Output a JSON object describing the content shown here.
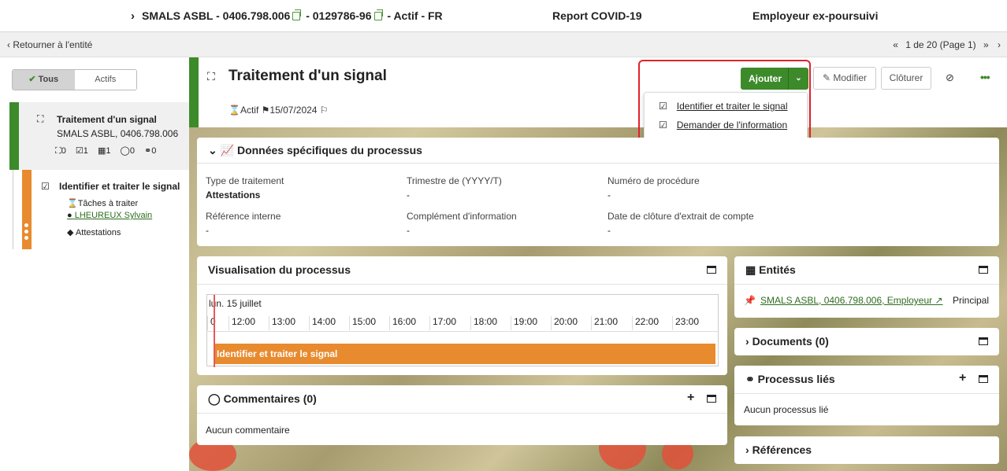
{
  "topbar": {
    "entity": "SMALS ASBL - 0406.798.006",
    "sep1": " - ",
    "code": "0129786-96",
    "status": " - Actif - FR",
    "report": "Report COVID-19",
    "employer": "Employeur ex-poursuivi"
  },
  "nav": {
    "back": "Retourner à l'entité",
    "pager": "1 de 20 (Page 1)"
  },
  "sidebar": {
    "toggle_all": "Tous",
    "toggle_active": "Actifs",
    "process": {
      "title": "Traitement d'un signal",
      "sub": "SMALS ASBL, 0406.798.006",
      "counts": [
        "0",
        "1",
        "1",
        "0",
        "0"
      ]
    },
    "task": {
      "title": "Identifier et traiter le signal",
      "status": "Tâches à traiter",
      "user": "LHEUREUX Sylvain",
      "tag": "Attestations"
    }
  },
  "header": {
    "title": "Traitement d'un signal",
    "status": "Actif",
    "date": "15/07/2024"
  },
  "actions": {
    "add": "Ajouter",
    "modify": "Modifier",
    "close": "Clôturer"
  },
  "menu": {
    "items": [
      "Identifier et traiter le signal",
      "Demander de l'information"
    ]
  },
  "specific": {
    "title": "Données spécifiques du processus",
    "fields": [
      {
        "label": "Type de traitement",
        "value": "Attestations"
      },
      {
        "label": "Trimestre de (YYYY/T)",
        "value": "-"
      },
      {
        "label": "Numéro de procédure",
        "value": "-"
      },
      {
        "label": "Référence interne",
        "value": "-"
      },
      {
        "label": "Complément d'information",
        "value": "-"
      },
      {
        "label": "Date de clôture d'extrait de compte",
        "value": "-"
      }
    ]
  },
  "visual": {
    "title": "Visualisation du processus",
    "day": "lun. 15 juillet",
    "hours": [
      "0",
      "12:00",
      "13:00",
      "14:00",
      "15:00",
      "16:00",
      "17:00",
      "18:00",
      "19:00",
      "20:00",
      "21:00",
      "22:00",
      "23:00"
    ],
    "bar": "Identifier et traiter le signal"
  },
  "comments": {
    "title": "Commentaires (0)",
    "empty": "Aucun commentaire"
  },
  "entities": {
    "title": "Entités",
    "link": "SMALS ASBL, 0406.798.006, Employeur",
    "role": "Principal"
  },
  "documents": {
    "title": "Documents (0)"
  },
  "linked": {
    "title": "Processus liés",
    "empty": "Aucun processus lié"
  },
  "references": {
    "title": "Références"
  },
  "colors": {
    "green": "#3d8a2a",
    "orange": "#e88a2e",
    "red": "#e0232b"
  }
}
